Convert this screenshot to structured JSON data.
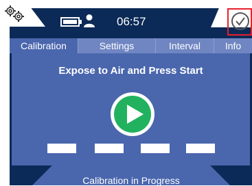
{
  "status_bar": {
    "time": "06:57",
    "icons": [
      "gear-icon",
      "battery-icon",
      "user-icon",
      "check-icon"
    ]
  },
  "tabs": [
    {
      "label": "Calibration",
      "active": true
    },
    {
      "label": "Settings",
      "active": false
    },
    {
      "label": "Interval",
      "active": false
    },
    {
      "label": "Info",
      "active": false
    }
  ],
  "main": {
    "instruction": "Expose to Air and Press Start",
    "play_icon": "play-icon"
  },
  "footer": {
    "status": "Calibration in Progress"
  },
  "colors": {
    "frame": "#0b2a57",
    "panel": "#4a66ad",
    "tab_inactive": "#6f86c2",
    "play_green": "#22b25f",
    "highlight_red": "#e8202a"
  }
}
